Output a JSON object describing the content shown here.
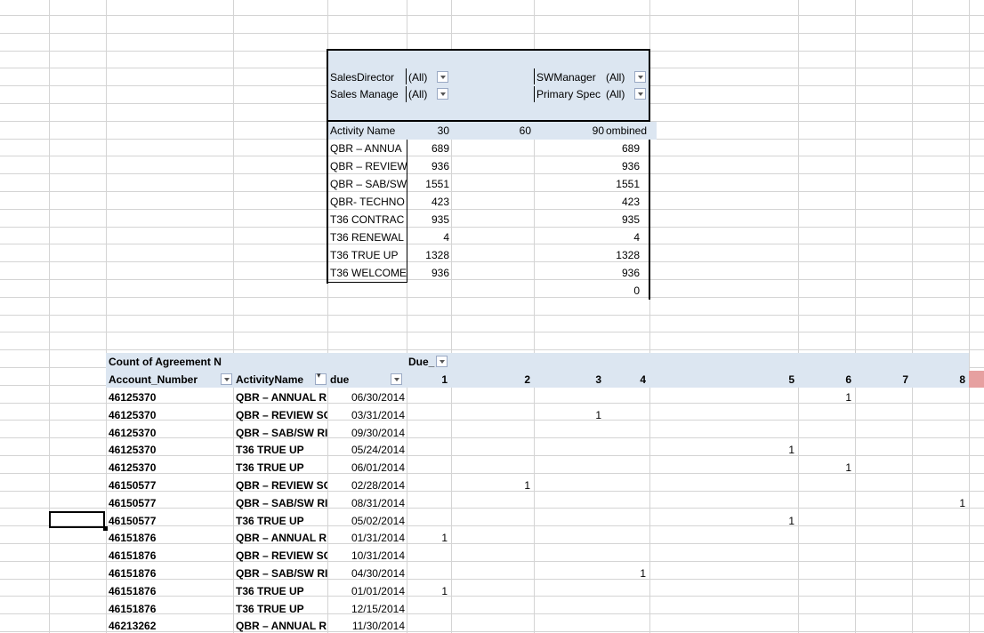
{
  "pivot1": {
    "filters": [
      {
        "label": "SalesDirector",
        "value": "(All)"
      },
      {
        "label": "Sales Manage",
        "value": "(All)"
      },
      {
        "label": "SWManager",
        "value": "(All)"
      },
      {
        "label": "Primary Spec",
        "value": "(All)"
      }
    ],
    "header": {
      "name": "Activity Name",
      "c30": "30",
      "c60": "60",
      "c90": "90",
      "combined": "ombined"
    },
    "rows": [
      {
        "name": "QBR – ANNUA",
        "v30": "689",
        "total": "689"
      },
      {
        "name": "QBR – REVIEW",
        "v30": "936",
        "total": "936"
      },
      {
        "name": "QBR – SAB/SW",
        "v30": "1551",
        "total": "1551"
      },
      {
        "name": "QBR- TECHNO",
        "v30": "423",
        "total": "423"
      },
      {
        "name": "T36 CONTRAC",
        "v30": "935",
        "total": "935"
      },
      {
        "name": "T36 RENEWAL",
        "v30": "4",
        "total": "4"
      },
      {
        "name": "T36 TRUE UP",
        "v30": "1328",
        "total": "1328"
      },
      {
        "name": "T36 WELCOME",
        "v30": "936",
        "total": "936"
      },
      {
        "name": "",
        "v30": "",
        "total": "0"
      }
    ]
  },
  "pivot2": {
    "title": "Count of Agreement N",
    "col_field": "Due_",
    "headers": {
      "account": "Account_Number",
      "activity": "ActivityName",
      "due": "due"
    },
    "col_numbers": [
      "1",
      "2",
      "3",
      "4",
      "5",
      "6",
      "7",
      "8"
    ],
    "rows": [
      {
        "acct": "46125370",
        "act": "QBR – ANNUAL R",
        "due": "06/30/2014",
        "col": "6",
        "val": "1"
      },
      {
        "acct": "46125370",
        "act": "QBR – REVIEW SC",
        "due": "03/31/2014",
        "col": "3",
        "val": "1"
      },
      {
        "acct": "46125370",
        "act": "QBR – SAB/SW RI",
        "due": "09/30/2014",
        "col": "",
        "val": ""
      },
      {
        "acct": "46125370",
        "act": "T36 TRUE UP",
        "due": "05/24/2014",
        "col": "5",
        "val": "1"
      },
      {
        "acct": "46125370",
        "act": "T36 TRUE UP",
        "due": "06/01/2014",
        "col": "6",
        "val": "1"
      },
      {
        "acct": "46150577",
        "act": "QBR – REVIEW SC",
        "due": "02/28/2014",
        "col": "2",
        "val": "1"
      },
      {
        "acct": "46150577",
        "act": "QBR – SAB/SW RI",
        "due": "08/31/2014",
        "col": "8",
        "val": "1"
      },
      {
        "acct": "46150577",
        "act": "T36 TRUE UP",
        "due": "05/02/2014",
        "col": "5",
        "val": "1"
      },
      {
        "acct": "46151876",
        "act": "QBR – ANNUAL R",
        "due": "01/31/2014",
        "col": "1",
        "val": "1"
      },
      {
        "acct": "46151876",
        "act": "QBR – REVIEW SC",
        "due": "10/31/2014",
        "col": "",
        "val": ""
      },
      {
        "acct": "46151876",
        "act": "QBR – SAB/SW RI",
        "due": "04/30/2014",
        "col": "4",
        "val": "1"
      },
      {
        "acct": "46151876",
        "act": "T36 TRUE UP",
        "due": "01/01/2014",
        "col": "1",
        "val": "1"
      },
      {
        "acct": "46151876",
        "act": "T36 TRUE UP",
        "due": "12/15/2014",
        "col": "",
        "val": ""
      },
      {
        "acct": "46213262",
        "act": "QBR – ANNUAL R",
        "due": "11/30/2014",
        "col": "",
        "val": ""
      }
    ]
  },
  "colors": {
    "grid": "#d4d4d4",
    "band": "#dce6f1",
    "accent": "#e6a0a0"
  }
}
